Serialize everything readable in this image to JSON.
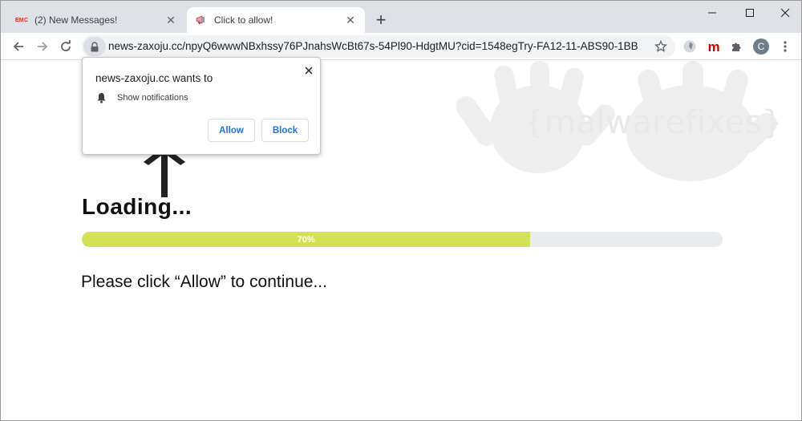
{
  "tabs": [
    {
      "favicon": "EMC",
      "title": "(2) New Messages!",
      "close": "✕"
    },
    {
      "favicon": "megaphone-icon",
      "title": "Click to allow!",
      "close": "✕"
    }
  ],
  "new_tab": "+",
  "window_controls": {
    "minimize": "minimize-icon",
    "maximize": "maximize-icon",
    "close": "close-icon"
  },
  "toolbar": {
    "url": "news-zaxoju.cc/npyQ6wwwNBxhssy76PJnahsWcBt67s-54Pl90-HdgtMU?cid=1548egTry-FA12-11-ABS90-1BB...",
    "extension_m": "m",
    "avatar_letter": "C"
  },
  "popup": {
    "title": "news-zaxoju.cc wants to",
    "permission": "Show notifications",
    "allow": "Allow",
    "block": "Block"
  },
  "watermark": "{malwarefixes}",
  "page": {
    "loading": "Loading...",
    "progress_percent": 70,
    "progress_label": "70%",
    "instruction": "Please click “Allow” to continue..."
  },
  "colors": {
    "progress_fill": "#d4e157",
    "progress_track": "#e9ecef",
    "link_blue": "#1a73e8",
    "tabstrip": "#dee1e6"
  }
}
